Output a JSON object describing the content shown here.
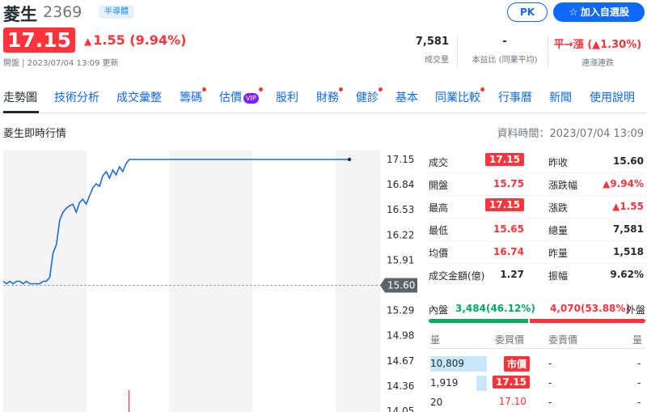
{
  "stock": {
    "name": "菱生",
    "code": "2369",
    "sector": "半導體",
    "price": "17.15",
    "change": "1.55 (9.94%)",
    "change_arrow": "▲",
    "timestamp": "開盤 | 2023/07/04 13:09 更新"
  },
  "buttons": {
    "pk": "PK",
    "watchlist": "加入自選股",
    "watchlist_icon": "☆"
  },
  "stats": [
    {
      "value": "7,581",
      "label": "成交量"
    },
    {
      "value": "-",
      "label": "本益比 (同業平均)"
    },
    {
      "value": "平→漲 (▲1.30%)",
      "label": "連漲連跌"
    }
  ],
  "tabs": [
    {
      "label": "走勢圖",
      "dot": false,
      "vip": false
    },
    {
      "label": "技術分析",
      "dot": false,
      "vip": false
    },
    {
      "label": "成交彙整",
      "dot": false,
      "vip": false
    },
    {
      "label": "籌碼",
      "dot": true,
      "vip": false
    },
    {
      "label": "估價",
      "dot": true,
      "vip": true
    },
    {
      "label": "股利",
      "dot": false,
      "vip": false
    },
    {
      "label": "財務",
      "dot": true,
      "vip": false
    },
    {
      "label": "健診",
      "dot": true,
      "vip": false
    },
    {
      "label": "基本",
      "dot": false,
      "vip": false
    },
    {
      "label": "同業比較",
      "dot": true,
      "vip": false
    },
    {
      "label": "行事曆",
      "dot": false,
      "vip": false
    },
    {
      "label": "新聞",
      "dot": false,
      "vip": false
    },
    {
      "label": "使用說明",
      "dot": false,
      "vip": false
    }
  ],
  "vip_label": "VIP",
  "section": {
    "title": "菱生即時行情",
    "data_time": "資料時間：2023/07/04 13:09"
  },
  "chart_data": {
    "type": "line",
    "y_ticks": [
      "17.15",
      "16.84",
      "16.53",
      "16.22",
      "15.91",
      "15.60",
      "15.29",
      "14.98",
      "14.67",
      "14.36",
      "14.05"
    ],
    "ylim": [
      14.05,
      17.15
    ],
    "reference_price": "15.60",
    "series": [
      {
        "values": [
          15.65,
          15.62,
          15.65,
          15.62,
          15.65,
          15.65,
          15.62,
          15.65,
          15.62,
          15.62,
          15.62,
          15.62,
          15.65,
          15.65,
          15.7,
          16.0,
          16.1,
          16.4,
          16.5,
          16.55,
          16.58,
          16.6,
          16.5,
          16.62,
          16.66,
          16.6,
          16.7,
          16.8,
          16.85,
          16.82,
          16.95,
          17.0,
          16.92,
          17.02,
          16.96,
          17.06,
          17.0,
          17.1,
          17.15,
          17.15,
          17.15
        ]
      }
    ],
    "line_color": "#1c6bd6",
    "volume_bar_present": true
  },
  "quote": {
    "rows": [
      {
        "l1": "成交",
        "v1": "17.15",
        "v1_style": "box",
        "l2": "昨收",
        "v2": "15.60",
        "v2_style": "dark"
      },
      {
        "l1": "開盤",
        "v1": "15.75",
        "v1_style": "red",
        "l2": "漲跌幅",
        "v2": "▲9.94%",
        "v2_style": "red"
      },
      {
        "l1": "最高",
        "v1": "17.15",
        "v1_style": "box",
        "l2": "漲跌",
        "v2": "▲1.55",
        "v2_style": "red"
      },
      {
        "l1": "最低",
        "v1": "15.65",
        "v1_style": "red",
        "l2": "總量",
        "v2": "7,581",
        "v2_style": "dark"
      },
      {
        "l1": "均價",
        "v1": "16.74",
        "v1_style": "red",
        "l2": "昨量",
        "v2": "1,518",
        "v2_style": "dark"
      },
      {
        "l1": "成交金額(億)",
        "v1": "1.27",
        "v1_style": "dark",
        "l2": "振幅",
        "v2": "9.62%",
        "v2_style": "dark"
      }
    ]
  },
  "flow": {
    "inner_label": "內盤",
    "inner_value": "3,484(46.12%)",
    "inner_pct": 46.12,
    "outer_value": "4,070(53.88%)",
    "outer_label": "外盤"
  },
  "orderbook": {
    "headers": {
      "bid_vol": "量",
      "bid_price": "委買價",
      "ask_price": "委賣價",
      "ask_vol": "量"
    },
    "rows": [
      {
        "vol": "10,809",
        "vol_frac": 1.0,
        "price": "市價",
        "price_box": true,
        "ask_price": "-",
        "ask_vol": "-"
      },
      {
        "vol": "1,919",
        "vol_frac": 0.18,
        "price": "17.15",
        "price_box": true,
        "ask_price": "-",
        "ask_vol": "-"
      },
      {
        "vol": "20",
        "vol_frac": 0,
        "price": "17.10",
        "price_box": false,
        "ask_price": "-",
        "ask_vol": "-"
      }
    ]
  }
}
